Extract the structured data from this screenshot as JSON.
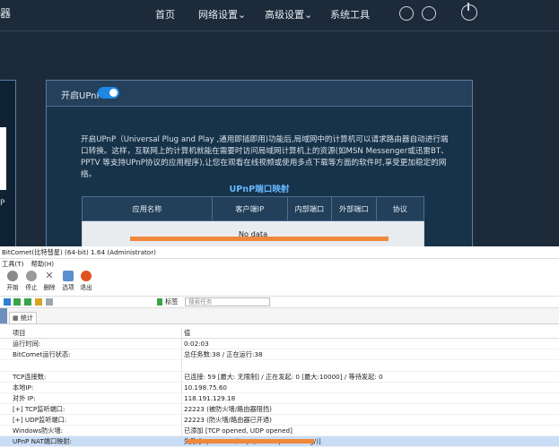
{
  "router": {
    "brand": "器",
    "nav": [
      "首页",
      "网络设置",
      "高级设置",
      "系统工具"
    ],
    "nav_dropdowns": [
      false,
      true,
      true,
      false
    ],
    "left_fragment": "P",
    "upnp": {
      "toggle_label": "开启UPnP",
      "toggle_on": true,
      "description": "开启UPnP（Universal Plug and Play ,通用即插即用)功能后,局域网中的计算机可以请求路由器自动进行端口转换。这样，互联网上的计算机就能在需要时访问局域网计算机上的资源(如MSN Messenger或迅雷BT、PPTV 等支持UPnP协议的应用程序),让您在观看在线视频或使用多点下载等方面的软件时,享受更加稳定的网络。",
      "mapping_title": "UPnP端口映射",
      "columns": [
        "应用名称",
        "客户端IP",
        "内部端口",
        "外部端口",
        "协议"
      ],
      "empty": "No data"
    },
    "colors": {
      "bg": "#1d2a3a",
      "accent": "#1e88e5",
      "highlight": "#f0883c"
    }
  },
  "bitcomet": {
    "title": "BitComet(比特彗星) (64-bit) 1.64 (Administrator)",
    "menu": [
      "工具(T)",
      "帮助(H)"
    ],
    "toolbar": [
      "开始",
      "停止",
      "删除",
      "选项",
      "退出"
    ],
    "tag_button": "标签",
    "search_placeholder": "搜索任务",
    "tab": "统计",
    "headers": [
      "项目",
      "值"
    ],
    "rows": [
      {
        "k": "运行时间:",
        "v": "0:02:03"
      },
      {
        "k": "BitComet运行状态:",
        "v": "总任务数:38 / 正在运行:38"
      },
      {
        "k": "",
        "v": ""
      },
      {
        "k": "TCP连接数:",
        "v": "已连接: 59 [最大: 无限制] / 正在发起: 0 [最大:10000] / 等待发起: 0"
      },
      {
        "k": "本地IP:",
        "v": "10.198.75.60"
      },
      {
        "k": "对外 IP:",
        "v": "118.191.129.18"
      },
      {
        "k": "[+] TCP监听端口:",
        "v": "22223 (被防火墙/路由器阻挡)"
      },
      {
        "k": "[+] UDP监听端口:",
        "v": "22223 (防火墙/路由器已开通)"
      },
      {
        "k": "Windows防火墙:",
        "v": "已添加 [TCP opened, UDP opened]"
      },
      {
        "k": "UPnP NAT端口映射:",
        "v": "失败 [OpenWRT (http://www.openwrt.org/)]"
      }
    ]
  }
}
